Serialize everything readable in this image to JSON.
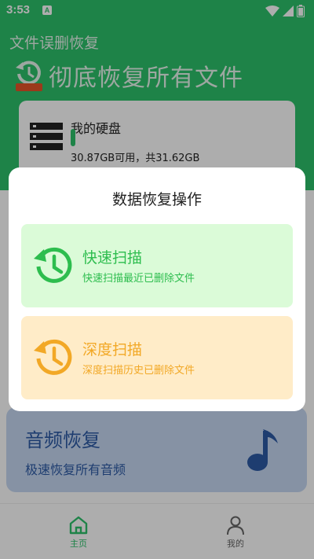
{
  "status_bar": {
    "time": "3:53",
    "notification_badge": "A"
  },
  "app_title": "文件误删恢复",
  "hero": {
    "text": "彻底恢复所有文件"
  },
  "disk": {
    "title": "我的硬盘",
    "usage": "30.87GB可用，共31.62GB",
    "used_fraction": 0.024
  },
  "audio_card": {
    "title": "音频恢复",
    "subtitle": "极速恢复所有音频"
  },
  "nav": {
    "home_label": "主页",
    "mine_label": "我的"
  },
  "dialog": {
    "title": "数据恢复操作",
    "quick": {
      "title": "快速扫描",
      "subtitle": "快速扫描最近已删除文件"
    },
    "deep": {
      "title": "深度扫描",
      "subtitle": "深度扫描历史已删除文件"
    }
  },
  "colors": {
    "primary_green": "#2dc26b",
    "quick_green": "#2dbd4e",
    "deep_orange": "#f2a826",
    "audio_blue": "#2d5aa6"
  },
  "icons": [
    "history-icon",
    "storage-icon",
    "music-note-icon",
    "home-icon",
    "person-icon",
    "wifi-icon",
    "signal-icon",
    "battery-icon"
  ]
}
